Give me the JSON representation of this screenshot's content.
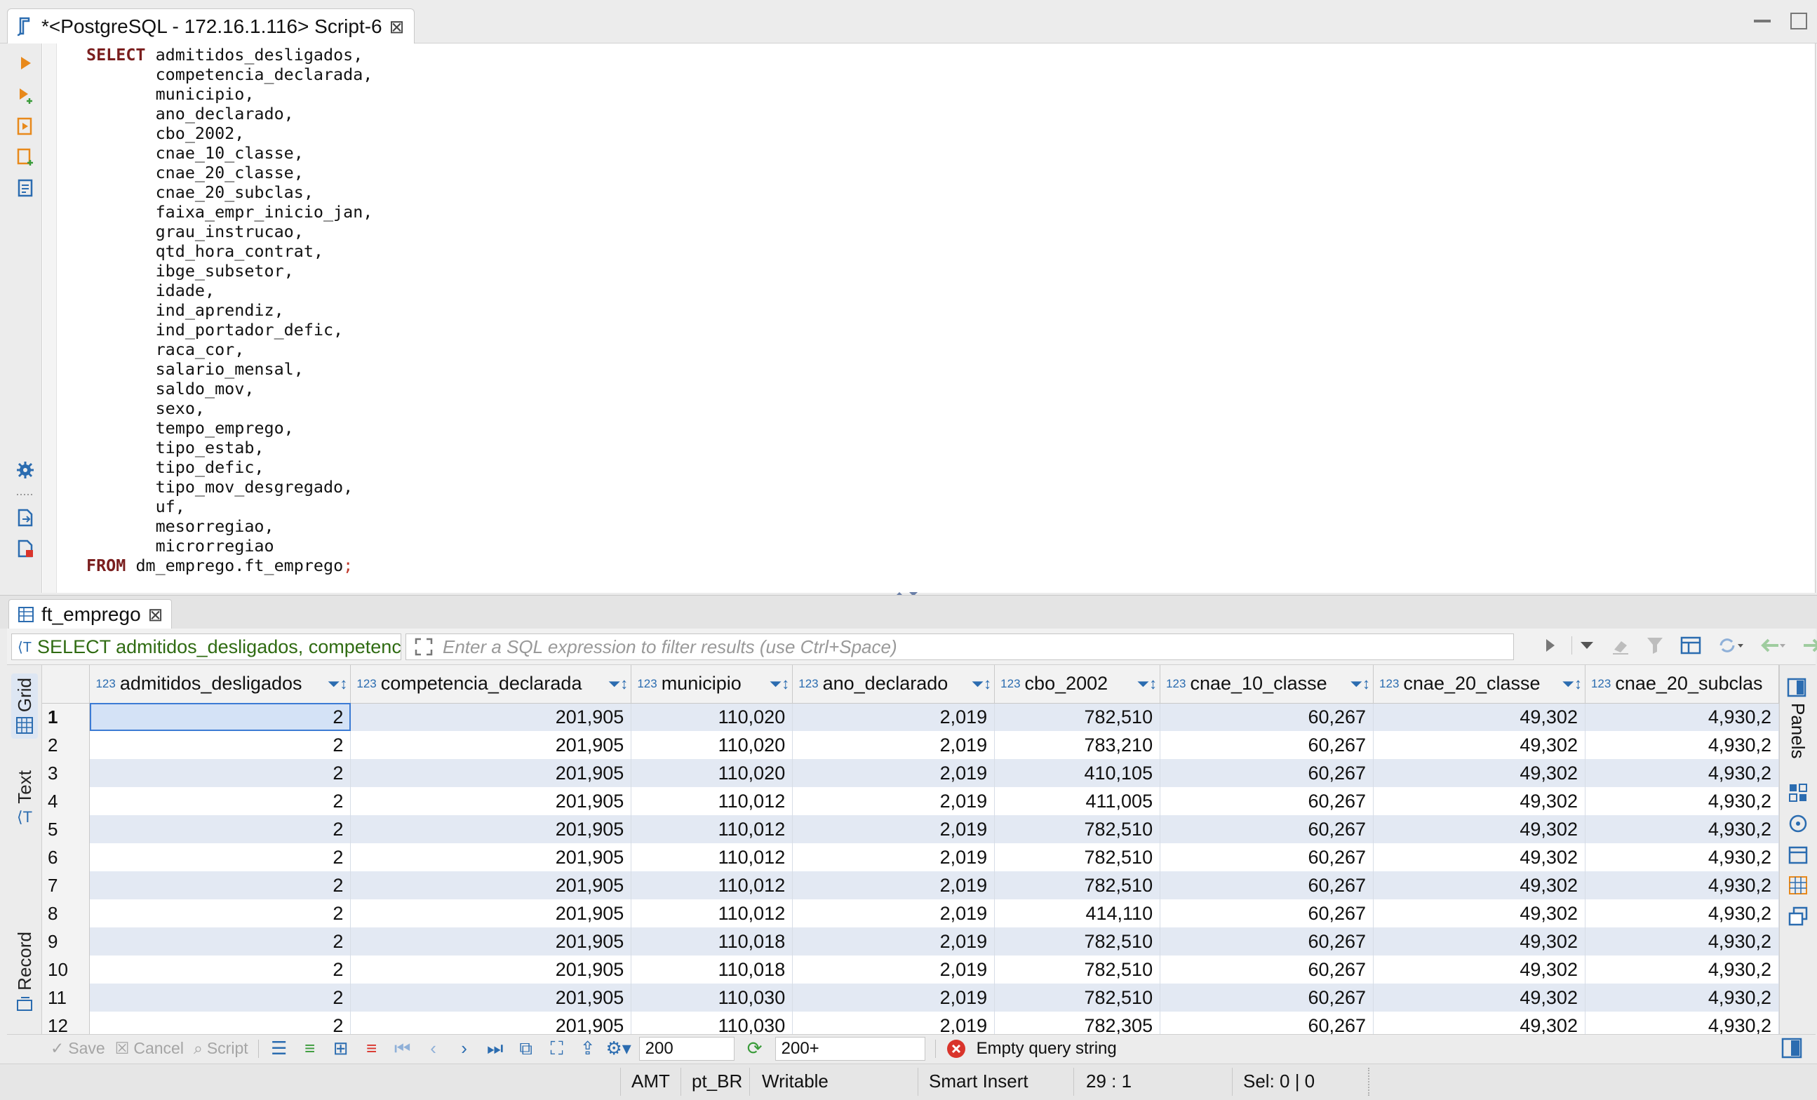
{
  "editor": {
    "tab_title": "*<PostgreSQL - 172.16.1.116> Script-6",
    "sql": {
      "select_kw": "SELECT",
      "columns": [
        "admitidos_desligados,",
        "competencia_declarada,",
        "municipio,",
        "ano_declarado,",
        "cbo_2002,",
        "cnae_10_classe,",
        "cnae_20_classe,",
        "cnae_20_subclas,",
        "faixa_empr_inicio_jan,",
        "grau_instrucao,",
        "qtd_hora_contrat,",
        "ibge_subsetor,",
        "idade,",
        "ind_aprendiz,",
        "ind_portador_defic,",
        "raca_cor,",
        "salario_mensal,",
        "saldo_mov,",
        "sexo,",
        "tempo_emprego,",
        "tipo_estab,",
        "tipo_defic,",
        "tipo_mov_desgregado,",
        "uf,",
        "mesorregiao,",
        "microrregiao"
      ],
      "from_kw": "FROM",
      "table": "dm_emprego.ft_emprego",
      "terminator": ";"
    }
  },
  "results": {
    "tab_title": "ft_emprego",
    "query_preview": "SELECT admitidos_desligados, competenc",
    "filter_placeholder": "Enter a SQL expression to filter results (use Ctrl+Space)",
    "side_tabs": [
      "Grid",
      "Text",
      "Record"
    ],
    "right_panel_label": "Panels",
    "grid": {
      "type_tag": "123",
      "columns": [
        "admitidos_desligados",
        "competencia_declarada",
        "municipio",
        "ano_declarado",
        "cbo_2002",
        "cnae_10_classe",
        "cnae_20_classe",
        "cnae_20_subclas"
      ],
      "rows": [
        {
          "n": "1",
          "cells": [
            "2",
            "201,905",
            "110,020",
            "2,019",
            "782,510",
            "60,267",
            "49,302",
            "4,930,2"
          ]
        },
        {
          "n": "2",
          "cells": [
            "2",
            "201,905",
            "110,020",
            "2,019",
            "783,210",
            "60,267",
            "49,302",
            "4,930,2"
          ]
        },
        {
          "n": "3",
          "cells": [
            "2",
            "201,905",
            "110,020",
            "2,019",
            "410,105",
            "60,267",
            "49,302",
            "4,930,2"
          ]
        },
        {
          "n": "4",
          "cells": [
            "2",
            "201,905",
            "110,012",
            "2,019",
            "411,005",
            "60,267",
            "49,302",
            "4,930,2"
          ]
        },
        {
          "n": "5",
          "cells": [
            "2",
            "201,905",
            "110,012",
            "2,019",
            "782,510",
            "60,267",
            "49,302",
            "4,930,2"
          ]
        },
        {
          "n": "6",
          "cells": [
            "2",
            "201,905",
            "110,012",
            "2,019",
            "782,510",
            "60,267",
            "49,302",
            "4,930,2"
          ]
        },
        {
          "n": "7",
          "cells": [
            "2",
            "201,905",
            "110,012",
            "2,019",
            "782,510",
            "60,267",
            "49,302",
            "4,930,2"
          ]
        },
        {
          "n": "8",
          "cells": [
            "2",
            "201,905",
            "110,012",
            "2,019",
            "414,110",
            "60,267",
            "49,302",
            "4,930,2"
          ]
        },
        {
          "n": "9",
          "cells": [
            "2",
            "201,905",
            "110,018",
            "2,019",
            "782,510",
            "60,267",
            "49,302",
            "4,930,2"
          ]
        },
        {
          "n": "10",
          "cells": [
            "2",
            "201,905",
            "110,018",
            "2,019",
            "782,510",
            "60,267",
            "49,302",
            "4,930,2"
          ]
        },
        {
          "n": "11",
          "cells": [
            "2",
            "201,905",
            "110,030",
            "2,019",
            "782,510",
            "60,267",
            "49,302",
            "4,930,2"
          ]
        },
        {
          "n": "12",
          "cells": [
            "2",
            "201,905",
            "110,030",
            "2,019",
            "782,305",
            "60,267",
            "49,302",
            "4,930,2"
          ]
        }
      ]
    },
    "toolbar": {
      "save": "Save",
      "cancel": "Cancel",
      "script": "Script",
      "fetch_size": "200",
      "row_count": "200+",
      "message": "Empty query string"
    }
  },
  "statusbar": {
    "timezone": "AMT",
    "locale": "pt_BR",
    "mode": "Writable",
    "insert_mode": "Smart Insert",
    "cursor": "29 : 1",
    "selection": "Sel: 0 | 0"
  },
  "colors": {
    "keyword": "#7a1e1e",
    "accent": "#2b6cb0",
    "row_alt": "#e3e9f3",
    "query_text": "#2f6b12"
  }
}
